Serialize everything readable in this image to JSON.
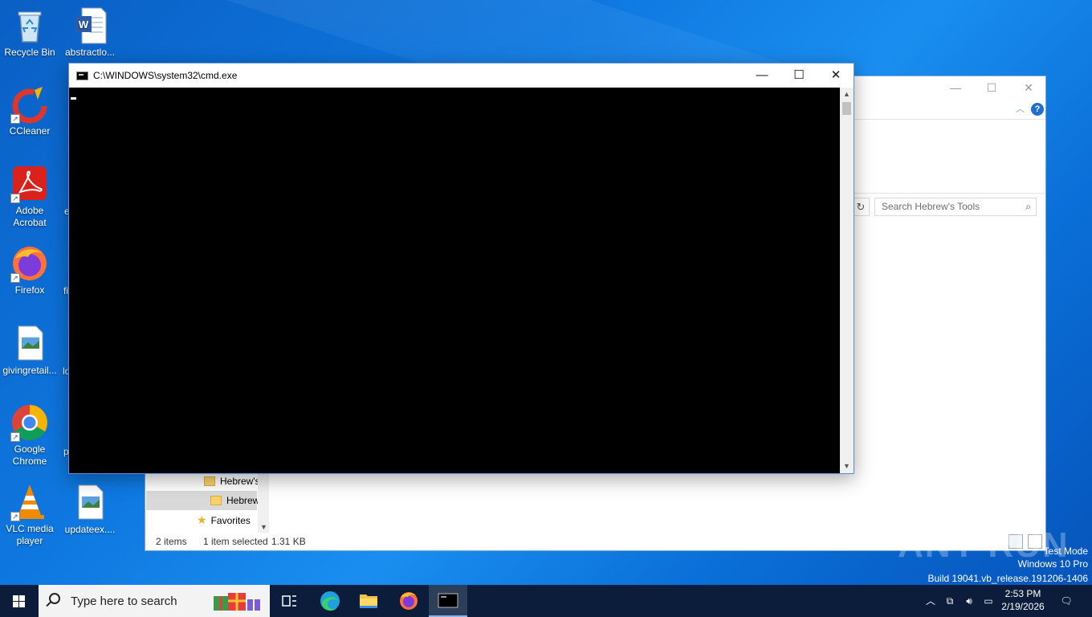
{
  "desktop": {
    "icons": [
      {
        "label": "Recycle Bin"
      },
      {
        "label": "abstractlo..."
      },
      {
        "label": "CCleaner"
      },
      {
        "label": "Adobe Acrobat"
      },
      {
        "label": "Firefox"
      },
      {
        "label": "givingretail..."
      },
      {
        "label": "Google Chrome"
      },
      {
        "label": "VLC media player"
      },
      {
        "label": "updateex...."
      }
    ],
    "partial_labels": [
      "e",
      "fi",
      "lo",
      "p"
    ]
  },
  "cmd": {
    "title": "C:\\WINDOWS\\system32\\cmd.exe",
    "minimize": "—",
    "maximize": "☐",
    "close": "✕"
  },
  "explorer": {
    "search_placeholder": "Search Hebrew's Tools",
    "nav": {
      "item1": "Hebrew's",
      "item2": "Hebrew",
      "favorites": "Favorites"
    },
    "status": {
      "items": "2 items",
      "selected": "1 item selected",
      "size": "1.31 KB"
    }
  },
  "watermark": {
    "text": "ANY RUN",
    "mode_line1": "Test Mode",
    "mode_line2": "Windows 10 Pro",
    "mode_line3": "Build 19041.vb_release.191206-1406"
  },
  "taskbar": {
    "search_placeholder": "Type here to search",
    "time": "2:53 PM",
    "date": "2/19/2026"
  }
}
